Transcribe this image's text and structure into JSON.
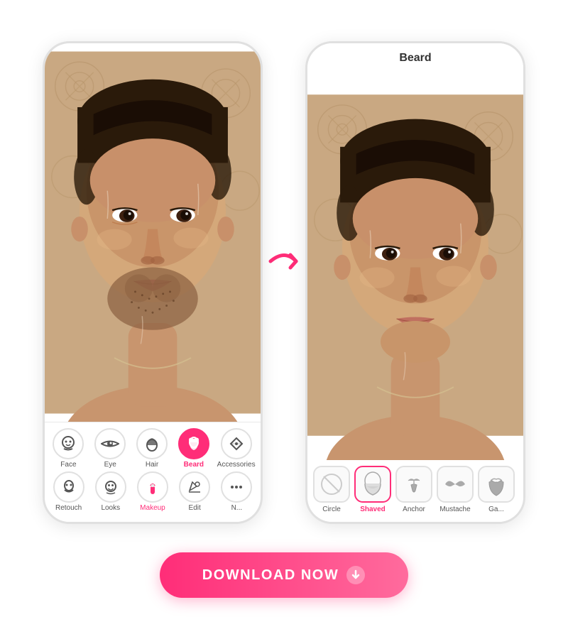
{
  "phones": {
    "left": {
      "toolbar_row1": [
        {
          "id": "face",
          "label": "Face",
          "active": false
        },
        {
          "id": "eye",
          "label": "Eye",
          "active": false
        },
        {
          "id": "hair",
          "label": "Hair",
          "active": false
        },
        {
          "id": "beard",
          "label": "Beard",
          "active": true
        },
        {
          "id": "accessories",
          "label": "Accessories",
          "active": false
        }
      ],
      "toolbar_row2": [
        {
          "id": "retouch",
          "label": "Retouch",
          "active": false
        },
        {
          "id": "looks",
          "label": "Looks",
          "active": false
        },
        {
          "id": "makeup",
          "label": "Makeup",
          "active": false,
          "pink": true
        },
        {
          "id": "edit",
          "label": "Edit",
          "active": false
        },
        {
          "id": "more",
          "label": "N...",
          "active": false
        }
      ]
    },
    "right": {
      "title": "Beard",
      "beard_options": [
        {
          "id": "circle",
          "label": "Circle",
          "active": false,
          "icon": "none"
        },
        {
          "id": "shaved",
          "label": "Shaved",
          "active": true,
          "icon": "shaved"
        },
        {
          "id": "anchor",
          "label": "Anchor",
          "active": false,
          "icon": "anchor"
        },
        {
          "id": "mustache",
          "label": "Mustache",
          "active": false,
          "icon": "mustache"
        },
        {
          "id": "ga",
          "label": "Ga...",
          "active": false,
          "icon": "ga"
        }
      ]
    }
  },
  "download": {
    "label": "DOWNLOAD NOW",
    "icon": "chevron-right-circle"
  },
  "arrow": {
    "color": "#ff2d78"
  }
}
